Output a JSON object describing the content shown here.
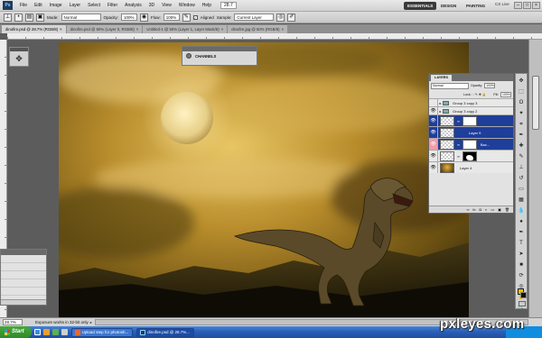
{
  "menubar": {
    "app_icon": "Ps",
    "items": [
      "File",
      "Edit",
      "Image",
      "Layer",
      "Select",
      "Filter",
      "Analysis",
      "3D",
      "View",
      "Window",
      "Help"
    ],
    "zoom": "28.7",
    "workspaces": [
      "ESSENTIALS",
      "DESIGN",
      "PAINTING"
    ],
    "cs_live": "CS Live",
    "window_buttons": [
      "–",
      "□",
      "×"
    ]
  },
  "options": {
    "mode_label": "Mode:",
    "mode_value": "Normal",
    "opacity_label": "Opacity:",
    "opacity_value": "100%",
    "flow_label": "Flow:",
    "flow_value": "100%",
    "aligned_label": "Aligned",
    "sample_label": "Sample:",
    "sample_value": "Current Layer"
  },
  "tabs": [
    {
      "label": "dinofire.psd @ 28.7% (RGB/8)",
      "active": true
    },
    {
      "label": "dinofire.psd @ 50% (Layer 0, RGB/8)",
      "active": false
    },
    {
      "label": "Untitled-1 @ 50% (Layer 1, Layer Mask/8)",
      "active": false
    },
    {
      "label": "dinofire.jpg @ 50% (RGB/8)",
      "active": false
    }
  ],
  "channels_panel": {
    "title": "CHANNELS"
  },
  "layers_panel": {
    "tab_label": "LAYERS",
    "blend_mode": "Normal",
    "opacity_label": "Opacity:",
    "opacity_value": "100%",
    "lock_label": "Lock:",
    "fill_label": "Fill:",
    "fill_value": "100%",
    "layers": [
      {
        "name": "Group 3 copy 3",
        "type": "group-partial"
      },
      {
        "name": "Group 3 copy 2",
        "type": "group"
      },
      {
        "name": "",
        "type": "mask-white",
        "selected": true
      },
      {
        "name": "Layer 9",
        "type": "layer",
        "selected": true
      },
      {
        "name": "Bac...",
        "type": "bg-selected",
        "selected": true
      },
      {
        "name": "",
        "type": "mask-shape"
      },
      {
        "name": "Layer 4",
        "type": "photo"
      }
    ]
  },
  "status": {
    "zoom": "28.7%",
    "message": "Exposure works in 32-bit only"
  },
  "taskbar": {
    "start": "Start",
    "tasks": [
      {
        "label": "Upload step for photosh...",
        "active": false
      },
      {
        "label": "dinofire.psd @ 28.7%...",
        "active": true
      }
    ]
  },
  "watermark": "pxleyes.com",
  "colors": {
    "foreground": "#e8c000",
    "background": "#111111",
    "selected_layer": "#1f3e9a",
    "taskbar": "#2a5fb8"
  }
}
